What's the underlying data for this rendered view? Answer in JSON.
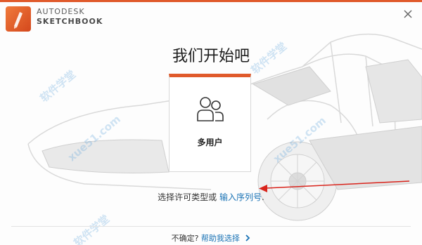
{
  "brand": {
    "line1": "AUTODESK",
    "line2": "SKETCHBOOK"
  },
  "title": "我们开始吧",
  "card": {
    "label": "多用户"
  },
  "license": {
    "prompt": "选择许可类型或",
    "link": "输入序列号",
    "suffix": "."
  },
  "footer": {
    "question": "不确定?",
    "help_link": "帮助我选择"
  },
  "watermarks": [
    "软件学堂",
    "xue51.com",
    "软件学堂",
    "xue51.com",
    "软件学堂"
  ],
  "colors": {
    "accent": "#e05a2b",
    "link": "#1a73b5",
    "arrow": "#d9241c"
  },
  "icons": {
    "app": "sketchbook-logo-icon",
    "close": "close-icon",
    "users": "multi-user-icon",
    "chevron": "chevron-right-icon"
  }
}
